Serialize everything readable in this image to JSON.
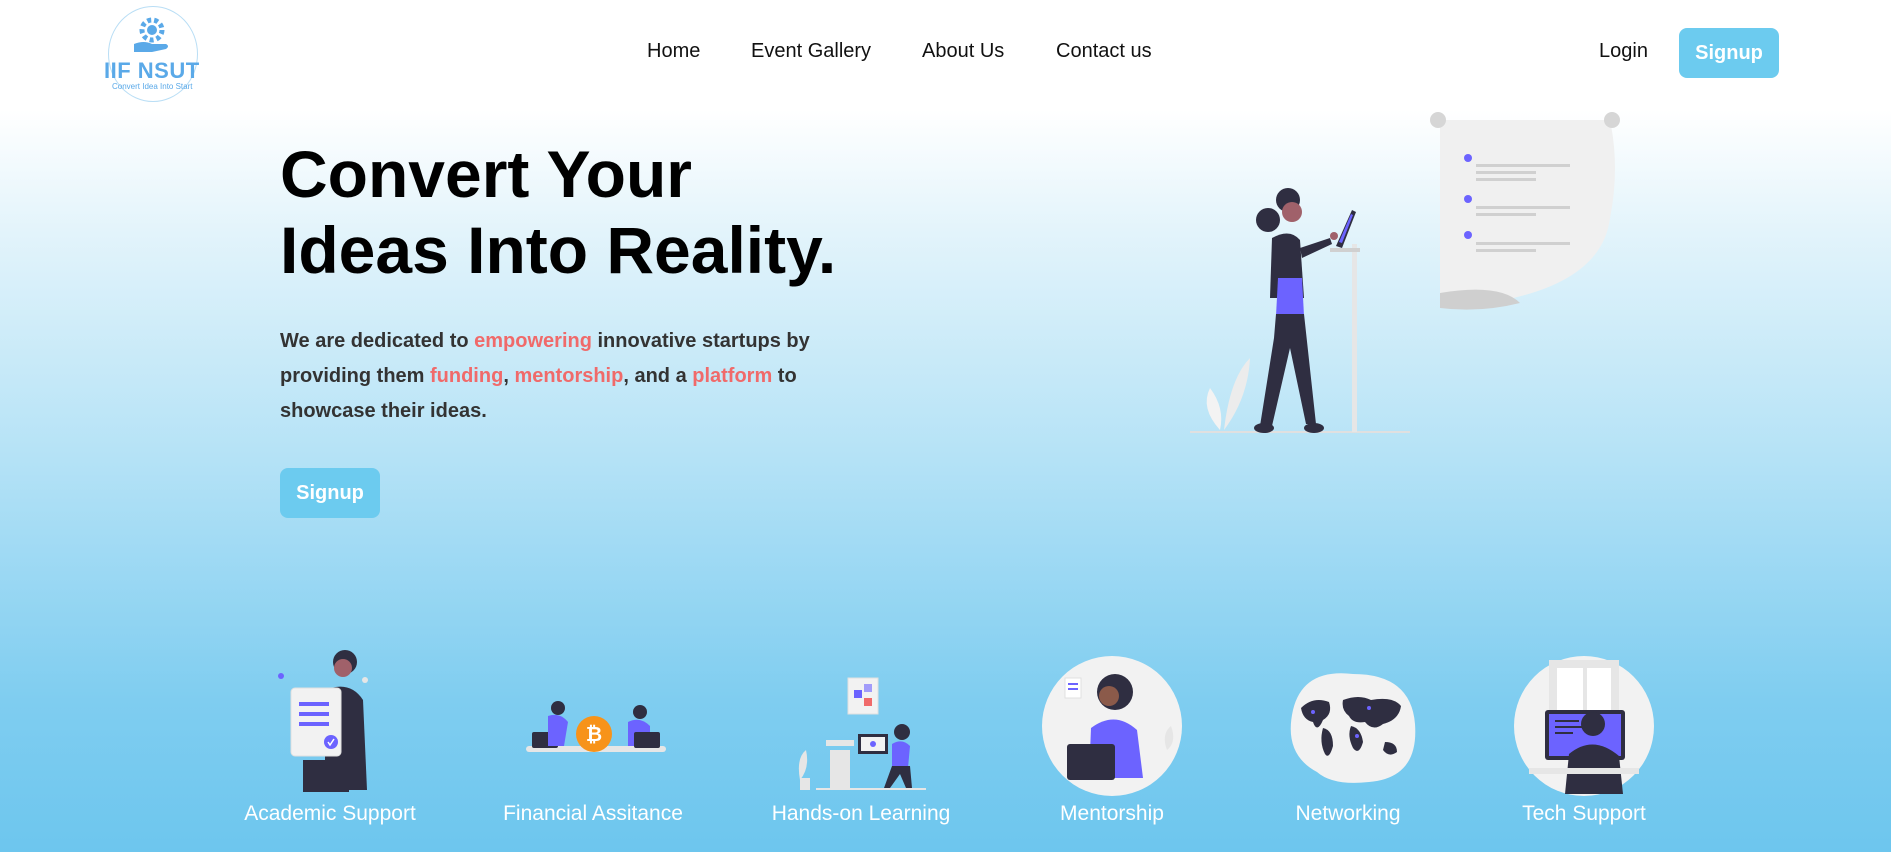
{
  "nav": {
    "logo_text": "IIF NSUT",
    "logo_tagline": "Convert Idea Into Start",
    "links": [
      "Home",
      "Event Gallery",
      "About Us",
      "Contact us"
    ],
    "login_label": "Login",
    "signup_label": "Signup"
  },
  "hero": {
    "title_line1": "Convert Your",
    "title_line2": "Ideas Into Reality.",
    "desc_parts": [
      "We are dedicated to ",
      "empowering",
      " innovative startups by providing them ",
      "funding",
      ", ",
      "mentorship",
      ", and a ",
      "platform",
      " to showcase their ideas."
    ],
    "signup_label": "Signup"
  },
  "features": [
    {
      "label": "Academic Support"
    },
    {
      "label": "Financial Assitance"
    },
    {
      "label": "Hands-on Learning"
    },
    {
      "label": "Mentorship"
    },
    {
      "label": "Networking"
    },
    {
      "label": "Tech Support"
    }
  ],
  "colors": {
    "accent": "#6ccbef",
    "highlight": "#f06a6a",
    "illustration_purple": "#6c63ff",
    "illustration_dark": "#2f2e41"
  }
}
